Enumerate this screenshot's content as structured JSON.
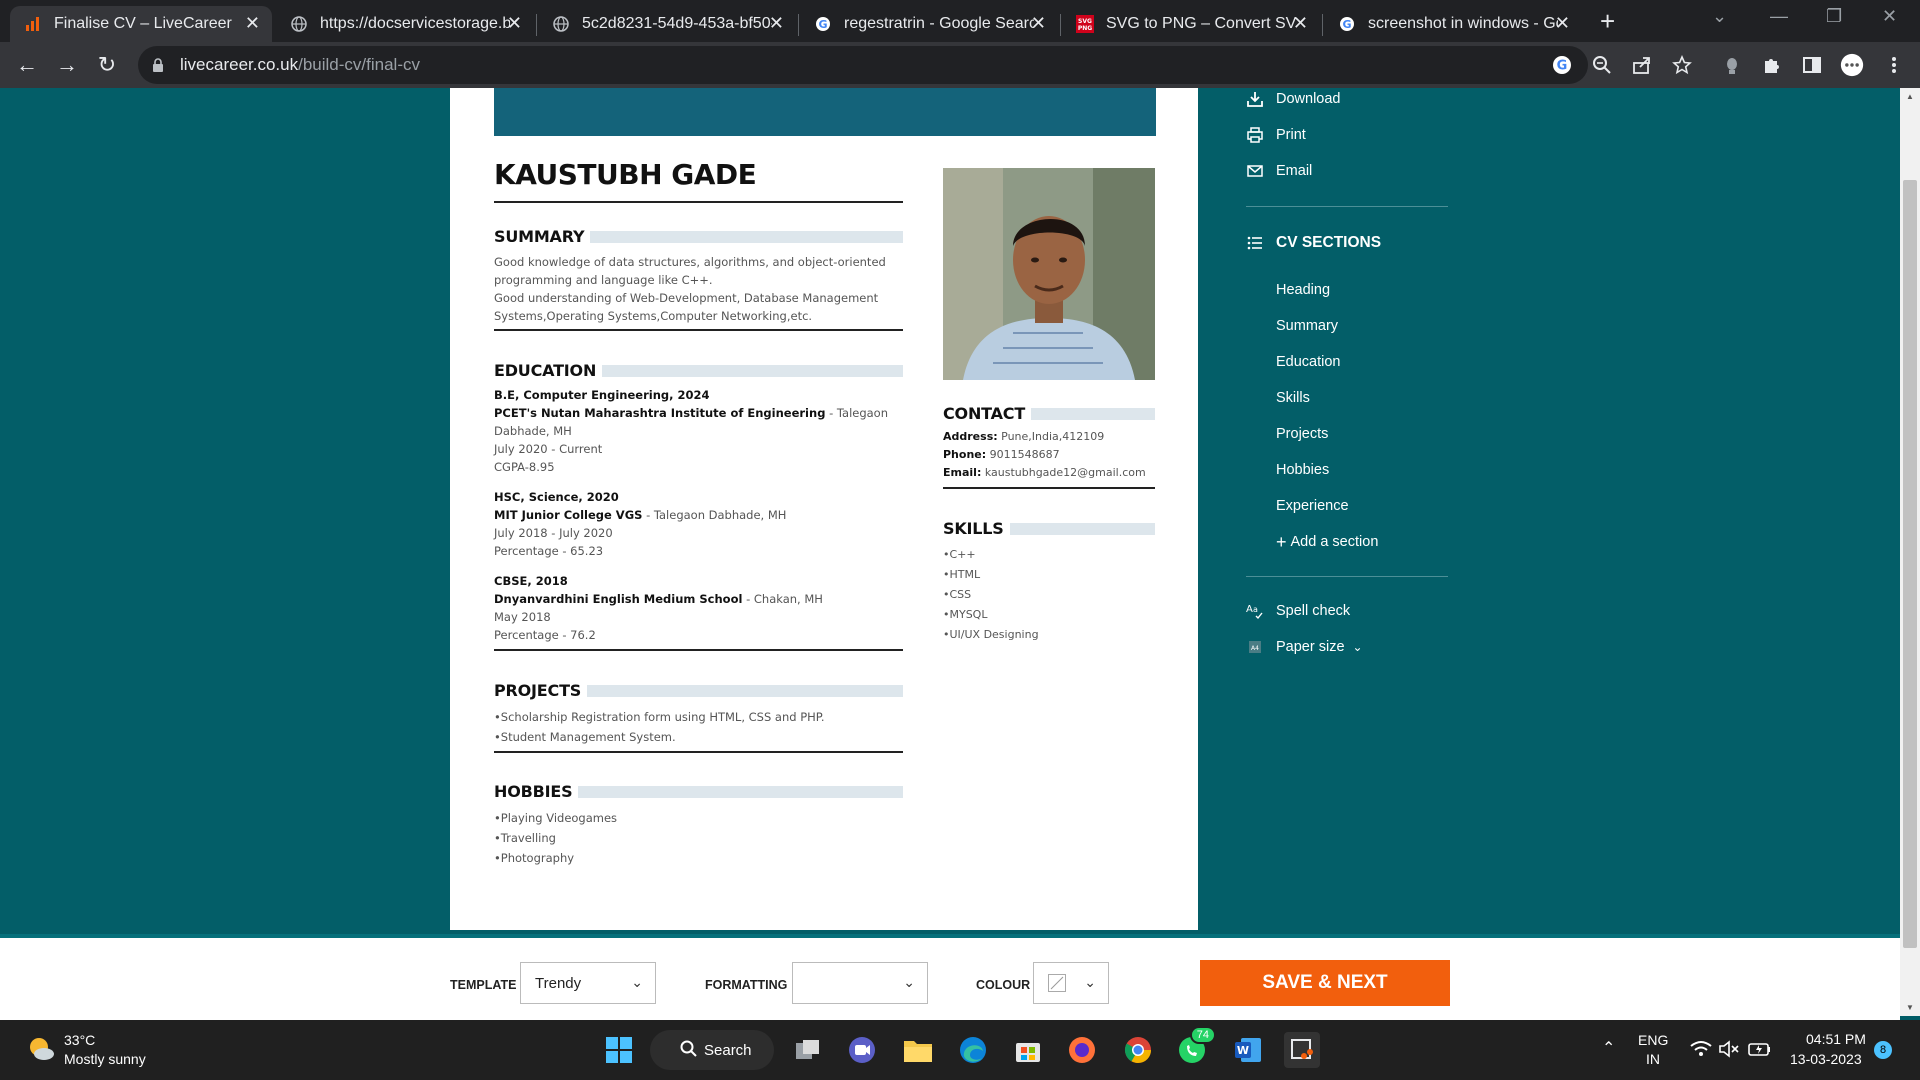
{
  "browser": {
    "tabs": [
      {
        "title": "Finalise CV – LiveCareer",
        "icon": "livecareer-icon",
        "active": true
      },
      {
        "title": "https://docservicestorage.b",
        "icon": "globe-icon"
      },
      {
        "title": "5c2d8231-54d9-453a-bf50-",
        "icon": "globe-icon"
      },
      {
        "title": "regestratrin - Google Searc",
        "icon": "google-icon"
      },
      {
        "title": "SVG to PNG – Convert SVG",
        "icon": "svg-png-icon"
      },
      {
        "title": "screenshot in windows - Go",
        "icon": "google-icon"
      }
    ],
    "url_host": "livecareer.co.uk",
    "url_path": "/build-cv/final-cv"
  },
  "cv": {
    "name": "KAUSTUBH GADE",
    "summary": {
      "heading": "SUMMARY",
      "lines": [
        "Good knowledge of data structures, algorithms, and object-oriented",
        "programming and language like C++.",
        "Good understanding of Web-Development, Database Management",
        "Systems,Operating Systems,Computer Networking,etc."
      ]
    },
    "education": {
      "heading": "EDUCATION",
      "entries": [
        {
          "degree": "B.E, Computer Engineering, 2024",
          "school": "PCET's Nutan Maharashtra Institute of Engineering",
          "location": " - Talegaon",
          "location2": "Dabhade, MH",
          "dates": "July 2020 - Current",
          "score": "CGPA-8.95"
        },
        {
          "degree": "HSC, Science, 2020",
          "school": "MIT Junior College VGS",
          "location": " - Talegaon Dabhade, MH",
          "dates": "July 2018 - July 2020",
          "score": "Percentage - 65.23"
        },
        {
          "degree": "CBSE, 2018",
          "school": "Dnyanvardhini English Medium School",
          "location": " - Chakan, MH",
          "dates": "May 2018",
          "score": "Percentage - 76.2"
        }
      ]
    },
    "projects": {
      "heading": "PROJECTS",
      "items": [
        "•Scholarship Registration form using HTML, CSS and PHP.",
        "•Student Management System."
      ]
    },
    "hobbies": {
      "heading": "HOBBIES",
      "items": [
        "•Playing Videogames",
        "•Travelling",
        "•Photography"
      ]
    },
    "contact": {
      "heading": "CONTACT",
      "address_label": "Address:",
      "address": " Pune,India,412109",
      "phone_label": "Phone:",
      "phone": " 9011548687",
      "email_label": "Email:",
      "email": " kaustubhgade12@gmail.com"
    },
    "skills": {
      "heading": "SKILLS",
      "items": [
        "•C++",
        "•HTML",
        "•CSS",
        "•MYSQL",
        "•UI/UX Designing"
      ]
    }
  },
  "side_panel": {
    "download": "Download",
    "print": "Print",
    "email": "Email",
    "cv_sections_title": "CV SECTIONS",
    "sections": [
      "Heading",
      "Summary",
      "Education",
      "Skills",
      "Projects",
      "Hobbies",
      "Experience"
    ],
    "add_section": "Add a section",
    "spell_check": "Spell check",
    "paper_size": "Paper size"
  },
  "bottom_bar": {
    "template_label": "TEMPLATE",
    "template_value": "Trendy",
    "formatting_label": "FORMATTING",
    "formatting_value": "",
    "colour_label": "COLOUR",
    "save_next": "SAVE & NEXT"
  },
  "taskbar": {
    "weather_temp": "33°C",
    "weather_desc": "Mostly sunny",
    "search": "Search",
    "whatsapp_badge": "74",
    "lang1": "ENG",
    "lang2": "IN",
    "time": "04:51 PM",
    "date": "13-03-2023",
    "notifications": "8"
  },
  "colors": {
    "page_bg": "#035e68",
    "cv_band": "#14637a",
    "save_button": "#f25f0d"
  }
}
